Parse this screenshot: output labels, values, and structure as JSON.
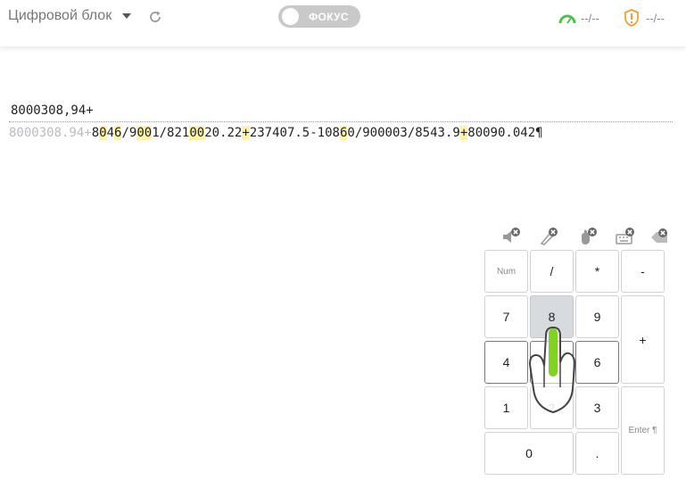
{
  "header": {
    "mode_title": "Цифровой блок",
    "focus_label": "ФОКУС",
    "speed_value": "--/--",
    "errors_value": "--/--"
  },
  "colors": {
    "accent_green": "#4cc24c",
    "accent_orange": "#f0a030",
    "highlight": "#fff3a8"
  },
  "exercise": {
    "input_text": "8000308,94+",
    "typed_text": "8000308.94+",
    "remaining_segments": [
      {
        "t": "8",
        "h": false
      },
      {
        "t": "0",
        "h": true
      },
      {
        "t": "4",
        "h": false
      },
      {
        "t": "6",
        "h": true
      },
      {
        "t": "/9",
        "h": false
      },
      {
        "t": "00",
        "h": true
      },
      {
        "t": "1/821",
        "h": false
      },
      {
        "t": "00",
        "h": true
      },
      {
        "t": "20.22",
        "h": false
      },
      {
        "t": "+",
        "h": true
      },
      {
        "t": "237407.5-108",
        "h": false
      },
      {
        "t": "6",
        "h": true
      },
      {
        "t": "0/900003/8543.9",
        "h": false
      },
      {
        "t": "+",
        "h": true
      },
      {
        "t": "80090.042¶",
        "h": false
      }
    ]
  },
  "toolbar_icons": [
    "sound-off-icon",
    "hint-off-icon",
    "hand-off-icon",
    "keyboard-off-icon",
    "backspace-off-icon"
  ],
  "numpad": {
    "num": "Num",
    "divide": "/",
    "multiply": "*",
    "minus": "-",
    "k7": "7",
    "k8": "8",
    "k9": "9",
    "plus": "+",
    "k4": "4",
    "k5": "5",
    "k6": "6",
    "k1": "1",
    "k2": "2",
    "k3": "3",
    "enter": "Enter ¶",
    "k0": "0",
    "dot": ".",
    "active_key": "8"
  }
}
